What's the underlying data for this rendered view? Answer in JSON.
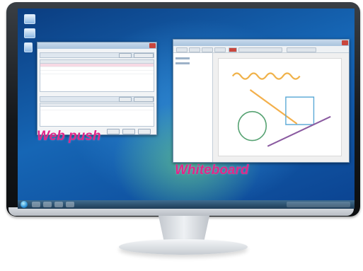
{
  "captions": {
    "web_push": "Web push",
    "whiteboard": "Whiteboard"
  },
  "colors": {
    "caption": "#e0278a",
    "screen_blue": "#1666b5",
    "wave": "#f0b24a",
    "orange_line": "#f3b04c",
    "green_circle": "#57a373",
    "blue_rect": "#5aa9d6",
    "purple_line": "#8a5aa0"
  },
  "icons": {
    "desktop": [
      "computer-icon",
      "network-icon",
      "folder-icon"
    ],
    "taskbar": [
      "start-orb-icon"
    ]
  }
}
